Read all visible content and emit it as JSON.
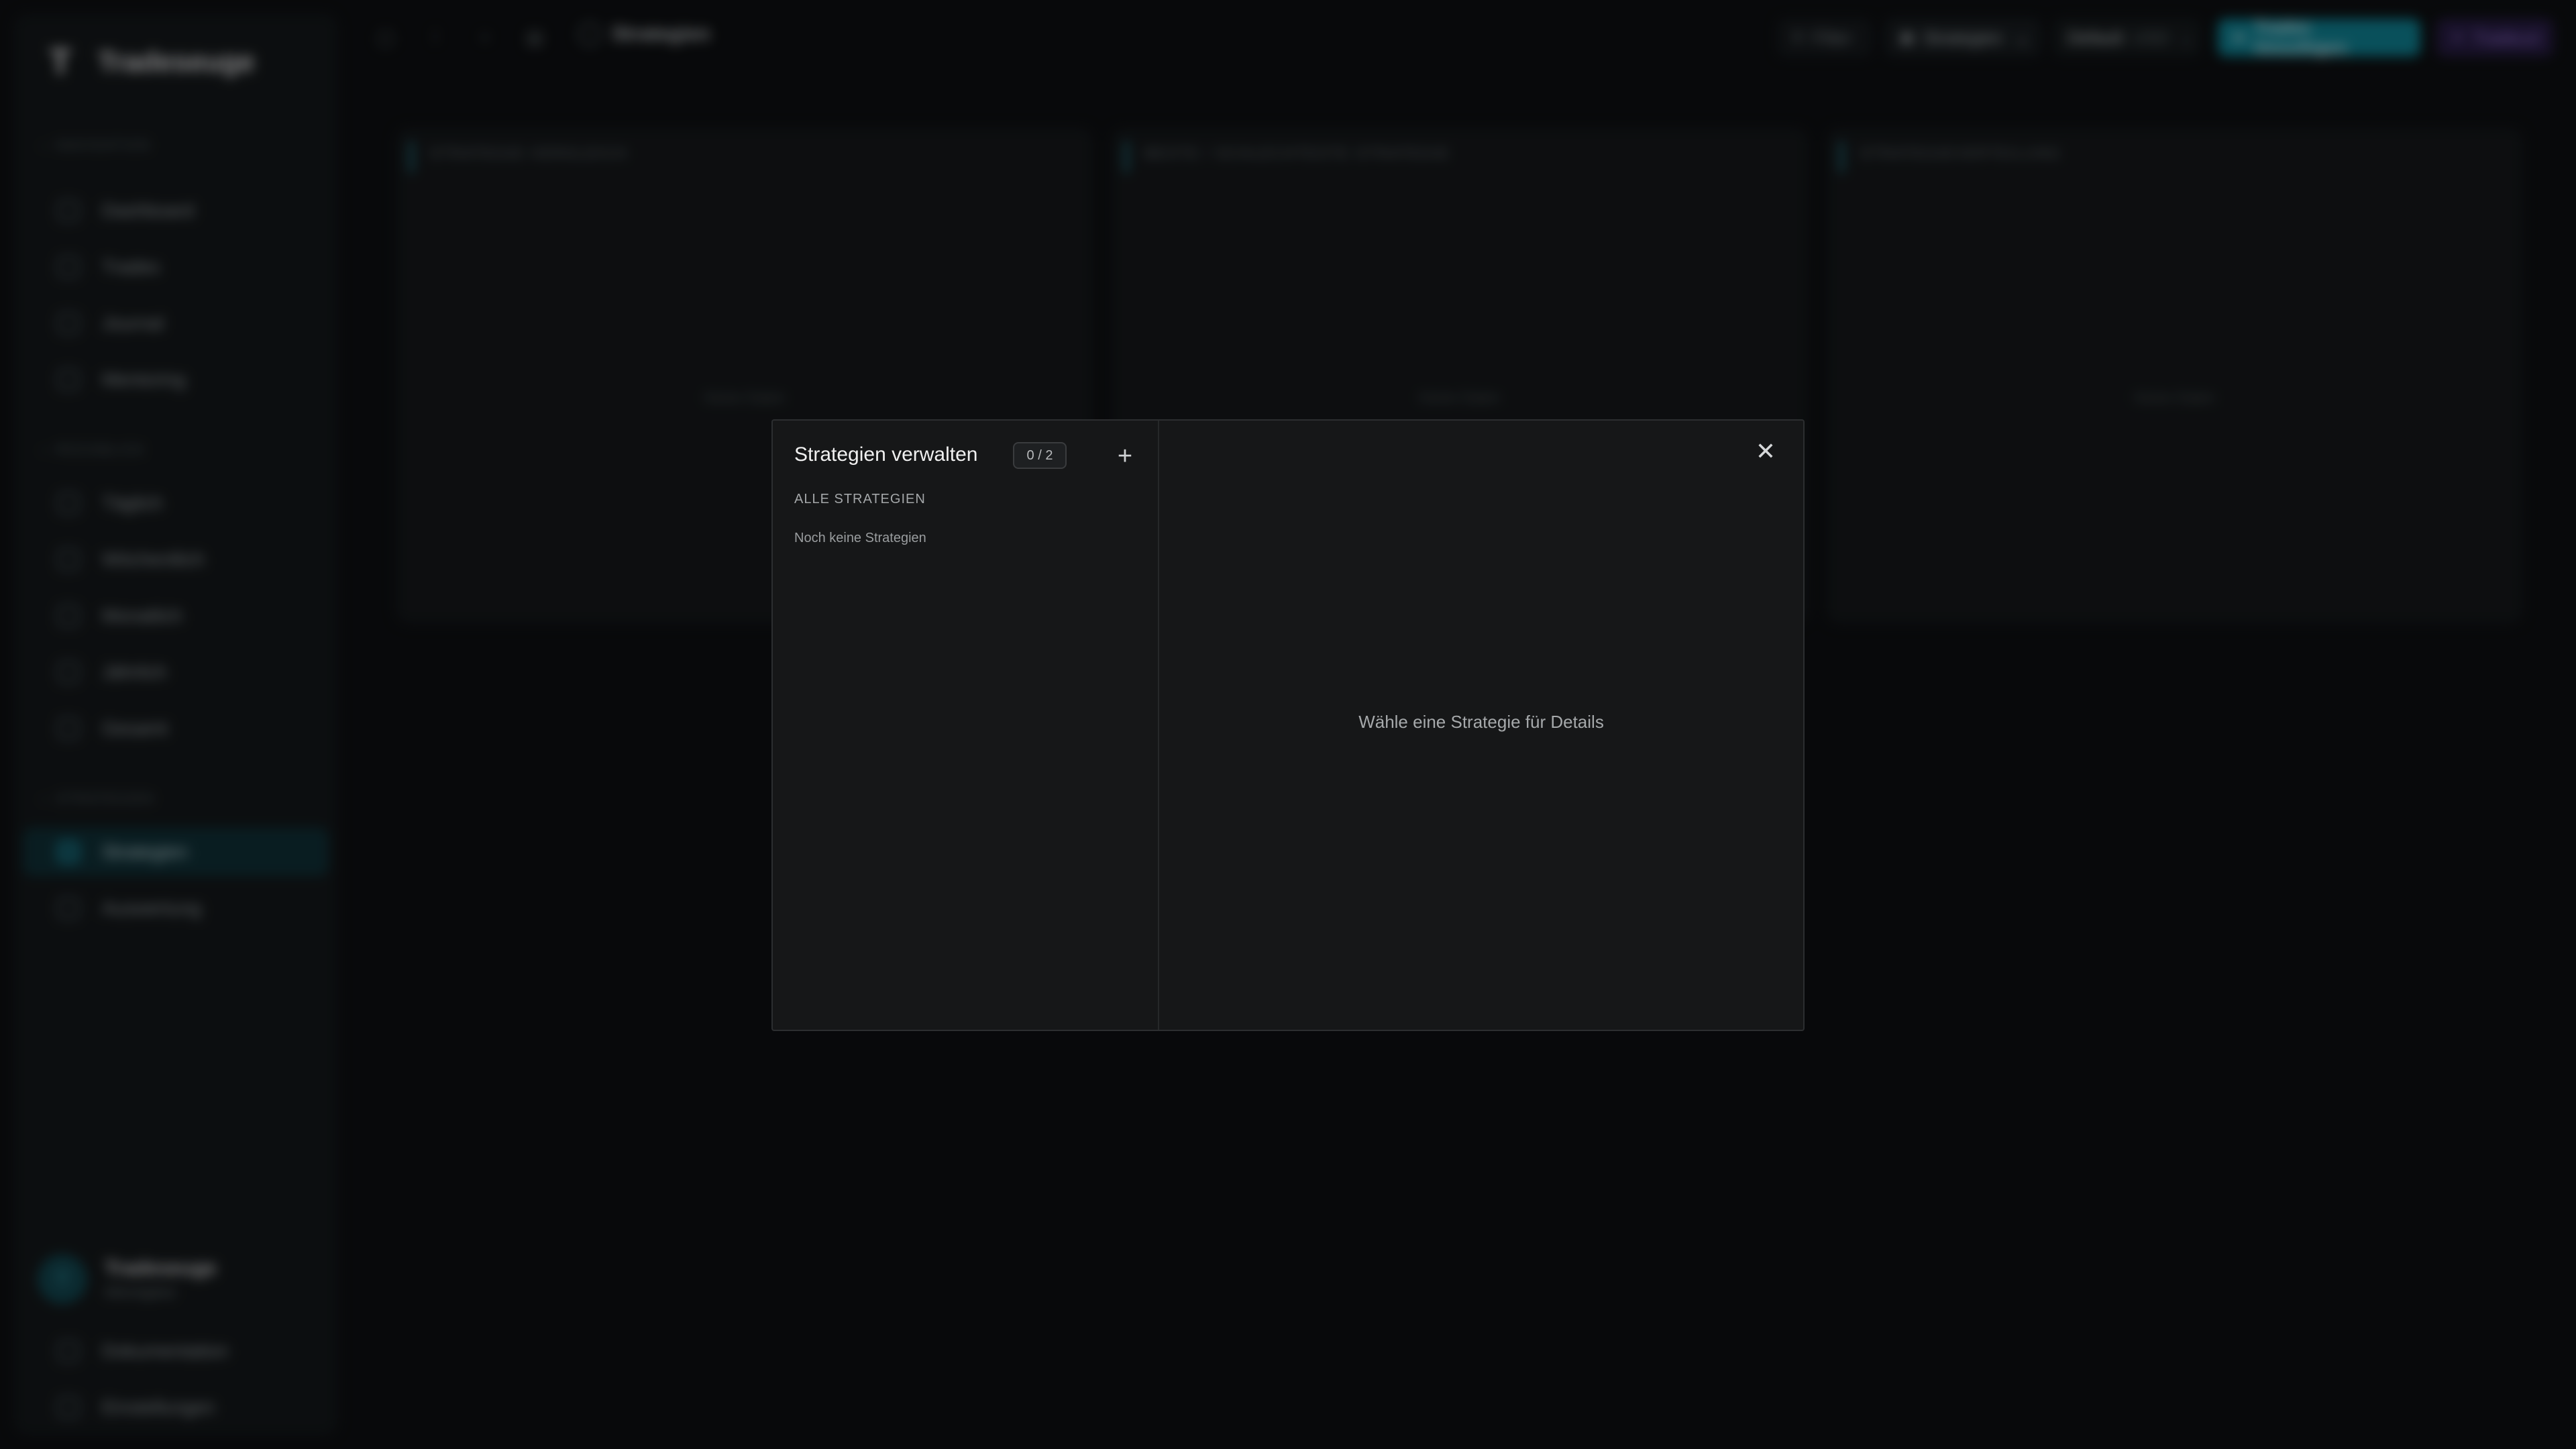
{
  "app": {
    "name": "Tradeseuge",
    "logo_glyph": "T"
  },
  "sidebar": {
    "sections": [
      {
        "label": "Navigation"
      },
      {
        "label": "Rückblick"
      },
      {
        "label": "Strategien"
      }
    ],
    "items": [
      {
        "label": "Dashboard",
        "icon": "dashboard-icon"
      },
      {
        "label": "Trades",
        "icon": "trades-icon"
      },
      {
        "label": "Journal",
        "icon": "journal-icon"
      },
      {
        "label": "Mentoring",
        "icon": "mentoring-icon"
      },
      {
        "label": "Täglich",
        "icon": "calendar-day-icon"
      },
      {
        "label": "Wöchentlich",
        "icon": "calendar-week-icon"
      },
      {
        "label": "Monatlich",
        "icon": "calendar-month-icon"
      },
      {
        "label": "Jährlich",
        "icon": "calendar-year-icon"
      },
      {
        "label": "Gesamt",
        "icon": "infinity-icon"
      },
      {
        "label": "Strategien",
        "icon": "strategy-icon",
        "active": true
      },
      {
        "label": "Auswertung",
        "icon": "analytics-icon"
      }
    ],
    "user": {
      "name": "Tradeseuge",
      "role": "Mitmitglied",
      "initial": "T"
    },
    "footer_items": [
      {
        "label": "Dokumentation",
        "icon": "docs-icon"
      },
      {
        "label": "Einstellungen",
        "icon": "settings-icon"
      }
    ]
  },
  "topbar": {
    "breadcrumb": "Strategien",
    "filter_label": "Filter",
    "strategy_select": "Strategien",
    "account_label": "Default",
    "account_currency": "USD",
    "add_trade_label": "Trades hinzufügen",
    "ai_label": "Tradeuzi"
  },
  "cards": [
    {
      "title": "Strategie-Vergleich",
      "empty": "Keine Daten"
    },
    {
      "title": "Beste / Schlechteste Strategie",
      "empty": "Keine Daten"
    },
    {
      "title": "Strategieverteilung",
      "empty": "Keine Daten"
    }
  ],
  "modal": {
    "title": "Strategien verwalten",
    "count": "0 / 2",
    "add_glyph": "+",
    "list_header": "Alle Strategien",
    "list_empty": "Noch keine Strategien",
    "close_glyph": "✕",
    "detail_placeholder": "Wähle eine Strategie für Details"
  },
  "colors": {
    "accent": "#0e8fa1",
    "active_nav": "#0e3238",
    "ai_purple": "#a67ff0",
    "modal_bg": "#161718"
  }
}
